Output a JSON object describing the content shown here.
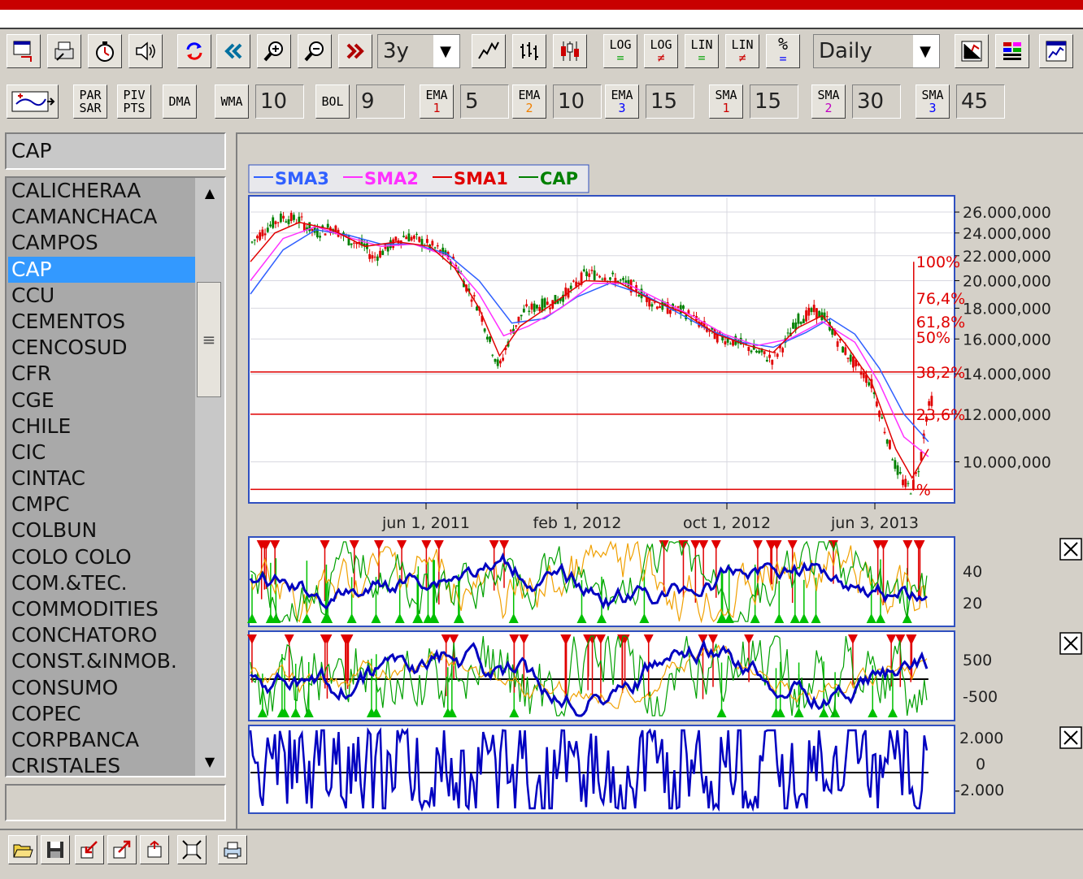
{
  "toolbar1": {
    "period_value": "3y",
    "interval_value": "Daily",
    "log_label": "LOG",
    "lin_label": "LIN",
    "percent_label": "%",
    "eq_symbol": "=",
    "neq_symbol": "≠"
  },
  "toolbar2": {
    "par_sar_label_1": "PAR",
    "par_sar_label_2": "SAR",
    "piv_pts_label_1": "PIV",
    "piv_pts_label_2": "PTS",
    "dma_label": "DMA",
    "wma_label": "WMA",
    "wma_value": "10",
    "bol_label": "BOL",
    "bol_value": "9",
    "ema_label": "EMA",
    "ema1_sub": "1",
    "ema1_value": "5",
    "ema2_sub": "2",
    "ema2_value": "10",
    "ema3_sub": "3",
    "ema3_value": "15",
    "sma_label": "SMA",
    "sma1_sub": "1",
    "sma1_value": "15",
    "sma2_sub": "2",
    "sma2_value": "30",
    "sma3_sub": "3",
    "sma3_value": "45"
  },
  "symbol_search_value": "CAP",
  "symbol_list": {
    "items": [
      "CALICHERAA",
      "CAMANCHACA",
      "CAMPOS",
      "CAP",
      "CCU",
      "CEMENTOS",
      "CENCOSUD",
      "CFR",
      "CGE",
      "CHILE",
      "CIC",
      "CINTAC",
      "CMPC",
      "COLBUN",
      "COLO COLO",
      "COM.&TEC.",
      "COMMODITIES",
      "CONCHATORO",
      "CONST.&INMOB.",
      "CONSUMO",
      "COPEC",
      "CORPBANCA",
      "CRISTALES"
    ],
    "selected_index": 3
  },
  "colors": {
    "sma3": "#3060ff",
    "sma2": "#ff30ff",
    "sma1": "#e00000",
    "cap": "#008000",
    "fib": "#e00000",
    "panel_main": "#0000c0",
    "panel_orange": "#f0a000",
    "panel_green": "#00a000"
  },
  "chart_data": {
    "type": "line",
    "legend": [
      "SMA3",
      "SMA2",
      "SMA1",
      "CAP"
    ],
    "legend_placement": "top-left",
    "y_ticks": [
      "26.000,000",
      "24.000,000",
      "22.000,000",
      "20.000,000",
      "18.000,000",
      "16.000,000",
      "14.000,000",
      "12.000,000",
      "10.000,000"
    ],
    "y_tick_values": [
      26000,
      24000,
      22000,
      20000,
      18000,
      16000,
      14000,
      12000,
      10000
    ],
    "y_scale": "log",
    "x_ticks": [
      "jun 1, 2011",
      "feb 1, 2012",
      "oct 1, 2012",
      "jun 3, 2013"
    ],
    "fib_labels": [
      "100%",
      "76,4%",
      "61,8%",
      "50%",
      "38,2%",
      "23,6%",
      "%"
    ],
    "fib_values": [
      21500,
      18700,
      17100,
      16100,
      14100,
      12000,
      9000
    ],
    "cap_series": [
      [
        0,
        23000
      ],
      [
        20,
        24500
      ],
      [
        40,
        25500
      ],
      [
        60,
        25200
      ],
      [
        80,
        24000
      ],
      [
        100,
        24600
      ],
      [
        120,
        23400
      ],
      [
        140,
        22800
      ],
      [
        150,
        21800
      ],
      [
        170,
        22800
      ],
      [
        190,
        23800
      ],
      [
        210,
        23200
      ],
      [
        230,
        22500
      ],
      [
        250,
        21500
      ],
      [
        265,
        19500
      ],
      [
        280,
        18000
      ],
      [
        295,
        15500
      ],
      [
        305,
        14300
      ],
      [
        320,
        16500
      ],
      [
        335,
        17800
      ],
      [
        355,
        18200
      ],
      [
        375,
        18500
      ],
      [
        395,
        19500
      ],
      [
        410,
        20500
      ],
      [
        430,
        20500
      ],
      [
        450,
        20000
      ],
      [
        470,
        19500
      ],
      [
        490,
        18500
      ],
      [
        510,
        18000
      ],
      [
        530,
        17800
      ],
      [
        550,
        17000
      ],
      [
        570,
        16200
      ],
      [
        590,
        15900
      ],
      [
        610,
        15500
      ],
      [
        630,
        15000
      ],
      [
        640,
        14800
      ],
      [
        655,
        15800
      ],
      [
        670,
        17200
      ],
      [
        690,
        17800
      ],
      [
        705,
        17300
      ],
      [
        720,
        15800
      ],
      [
        740,
        14500
      ],
      [
        760,
        13500
      ],
      [
        775,
        11500
      ],
      [
        790,
        9800
      ],
      [
        800,
        9200
      ],
      [
        810,
        9000
      ],
      [
        820,
        10000
      ],
      [
        828,
        12000
      ],
      [
        835,
        12800
      ]
    ],
    "sma1_series": [
      [
        0,
        21500
      ],
      [
        30,
        24000
      ],
      [
        60,
        25000
      ],
      [
        100,
        24300
      ],
      [
        140,
        22800
      ],
      [
        180,
        23200
      ],
      [
        220,
        22800
      ],
      [
        250,
        21000
      ],
      [
        280,
        18000
      ],
      [
        305,
        15000
      ],
      [
        330,
        16800
      ],
      [
        370,
        18300
      ],
      [
        410,
        20000
      ],
      [
        450,
        19900
      ],
      [
        490,
        18600
      ],
      [
        530,
        17700
      ],
      [
        570,
        16300
      ],
      [
        610,
        15600
      ],
      [
        640,
        15200
      ],
      [
        670,
        16700
      ],
      [
        700,
        17500
      ],
      [
        730,
        15600
      ],
      [
        760,
        13600
      ],
      [
        790,
        10500
      ],
      [
        810,
        9400
      ],
      [
        830,
        10500
      ]
    ],
    "sma2_series": [
      [
        0,
        20000
      ],
      [
        40,
        23500
      ],
      [
        80,
        24600
      ],
      [
        120,
        23600
      ],
      [
        160,
        22800
      ],
      [
        200,
        23000
      ],
      [
        240,
        22000
      ],
      [
        280,
        19000
      ],
      [
        310,
        16200
      ],
      [
        340,
        16800
      ],
      [
        380,
        18000
      ],
      [
        420,
        19800
      ],
      [
        460,
        19800
      ],
      [
        500,
        18600
      ],
      [
        540,
        17500
      ],
      [
        580,
        16300
      ],
      [
        620,
        15600
      ],
      [
        660,
        16000
      ],
      [
        700,
        17100
      ],
      [
        740,
        15800
      ],
      [
        770,
        13500
      ],
      [
        800,
        11000
      ],
      [
        830,
        10200
      ]
    ],
    "sma3_series": [
      [
        0,
        19000
      ],
      [
        40,
        22500
      ],
      [
        80,
        24300
      ],
      [
        120,
        23800
      ],
      [
        160,
        23000
      ],
      [
        200,
        23000
      ],
      [
        240,
        22200
      ],
      [
        280,
        20000
      ],
      [
        320,
        17000
      ],
      [
        360,
        17300
      ],
      [
        400,
        18800
      ],
      [
        440,
        19800
      ],
      [
        480,
        19000
      ],
      [
        520,
        17800
      ],
      [
        560,
        16600
      ],
      [
        600,
        15800
      ],
      [
        640,
        15500
      ],
      [
        680,
        16400
      ],
      [
        710,
        17300
      ],
      [
        740,
        16300
      ],
      [
        770,
        14300
      ],
      [
        800,
        12000
      ],
      [
        830,
        10800
      ]
    ],
    "panel1_ticks": [
      "40",
      "20"
    ],
    "panel1_tick_values": [
      40,
      20
    ],
    "panel2_ticks": [
      "500",
      "-500"
    ],
    "panel2_tick_values": [
      500,
      -500
    ],
    "panel3_ticks": [
      "2.000",
      "0",
      "-2.000"
    ],
    "panel3_tick_values": [
      2000,
      0,
      -2000
    ]
  }
}
